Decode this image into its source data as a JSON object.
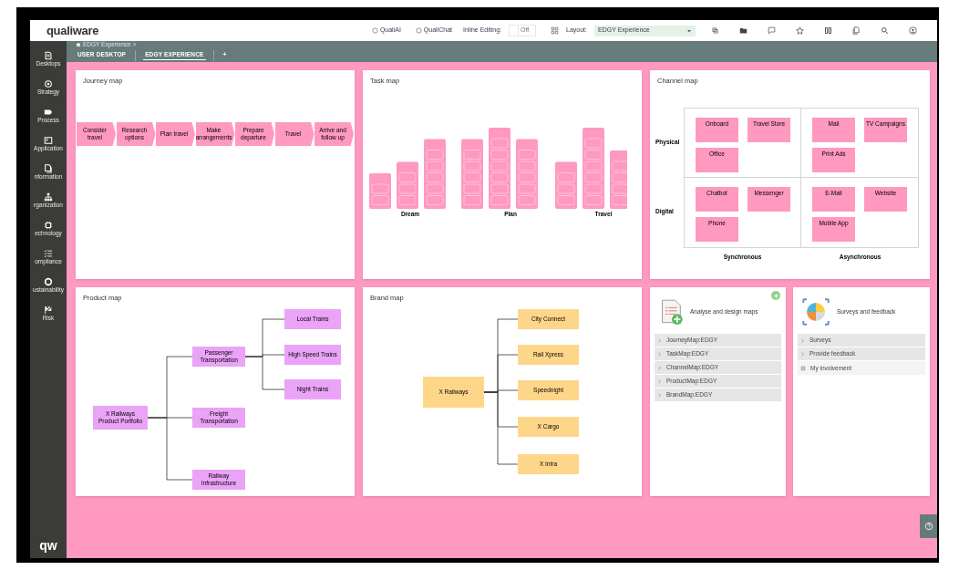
{
  "header": {
    "logo": "qualiware",
    "links": [
      "QualiAI",
      "QualiChat"
    ],
    "inline_editing": {
      "label": "Inline Editing:",
      "on": false,
      "state_text": "Off"
    },
    "layout": {
      "label": "Layout:",
      "value": "EDGY Experience"
    }
  },
  "breadcrumb": "EDGY Experience >",
  "tabs": [
    {
      "label": "USER DESKTOP",
      "selected": false
    },
    {
      "label": "EDGY EXPERIENCE",
      "selected": true
    },
    {
      "label": "+",
      "selected": false
    }
  ],
  "sidebar": {
    "items": [
      "Desktops",
      "Strategy",
      "Process",
      "Application",
      "nformation",
      "rganization",
      "echnology",
      "ompliance",
      "ustainability",
      "Risk"
    ],
    "logo": "qw"
  },
  "journey_map": {
    "title": "Journey map",
    "steps": [
      "Consider travel",
      "Research options",
      "Plan travel",
      "Make arrangements",
      "Prepare departure",
      "Travel",
      "Arrive and follow up"
    ]
  },
  "task_map": {
    "title": "Task map",
    "groups": [
      "Dream",
      "Plan",
      "Travel"
    ]
  },
  "channel_map": {
    "title": "Channel map",
    "rows": [
      "Physical",
      "Digital"
    ],
    "columns": [
      "Synchronous",
      "Asynchronous"
    ],
    "cells": [
      [
        "Onboard",
        "Travel Store",
        "Office"
      ],
      [
        "Mail",
        "TV Campaigns",
        "Print Ads"
      ],
      [
        "Chatbot",
        "Messenger",
        "Phone"
      ],
      [
        "E-Mail",
        "Website",
        "Mobile App"
      ]
    ]
  },
  "product_map": {
    "title": "Product map",
    "root": "X Railways Product Portfolio",
    "children": [
      {
        "label": "Passenger Transportation",
        "children": [
          {
            "label": "Local Trains"
          },
          {
            "label": "High Speed Trains"
          },
          {
            "label": "Night Trains"
          }
        ]
      },
      {
        "label": "Freight Transportation"
      },
      {
        "label": "Railway Infrastructure"
      }
    ]
  },
  "brand_map": {
    "title": "Brand map",
    "root": "X Railways",
    "children": [
      "City Connect",
      "Rail Xpress",
      "Speednight",
      "X Cargo",
      "X Intra"
    ]
  },
  "analyse_panel": {
    "title": "Analyse and design maps",
    "items": [
      "JourneyMap:EDGY",
      "TaskMap:EDGY",
      "ChannelMap:EDGY",
      "ProductMap:EDGY",
      "BrandMap:EDGY"
    ]
  },
  "surveys_panel": {
    "title": "Surveys and feedback",
    "items": [
      {
        "label": "Surveys",
        "kind": "expander"
      },
      {
        "label": "Provide feedback",
        "kind": "expander"
      },
      {
        "label": "My involvement",
        "kind": "link"
      }
    ]
  }
}
